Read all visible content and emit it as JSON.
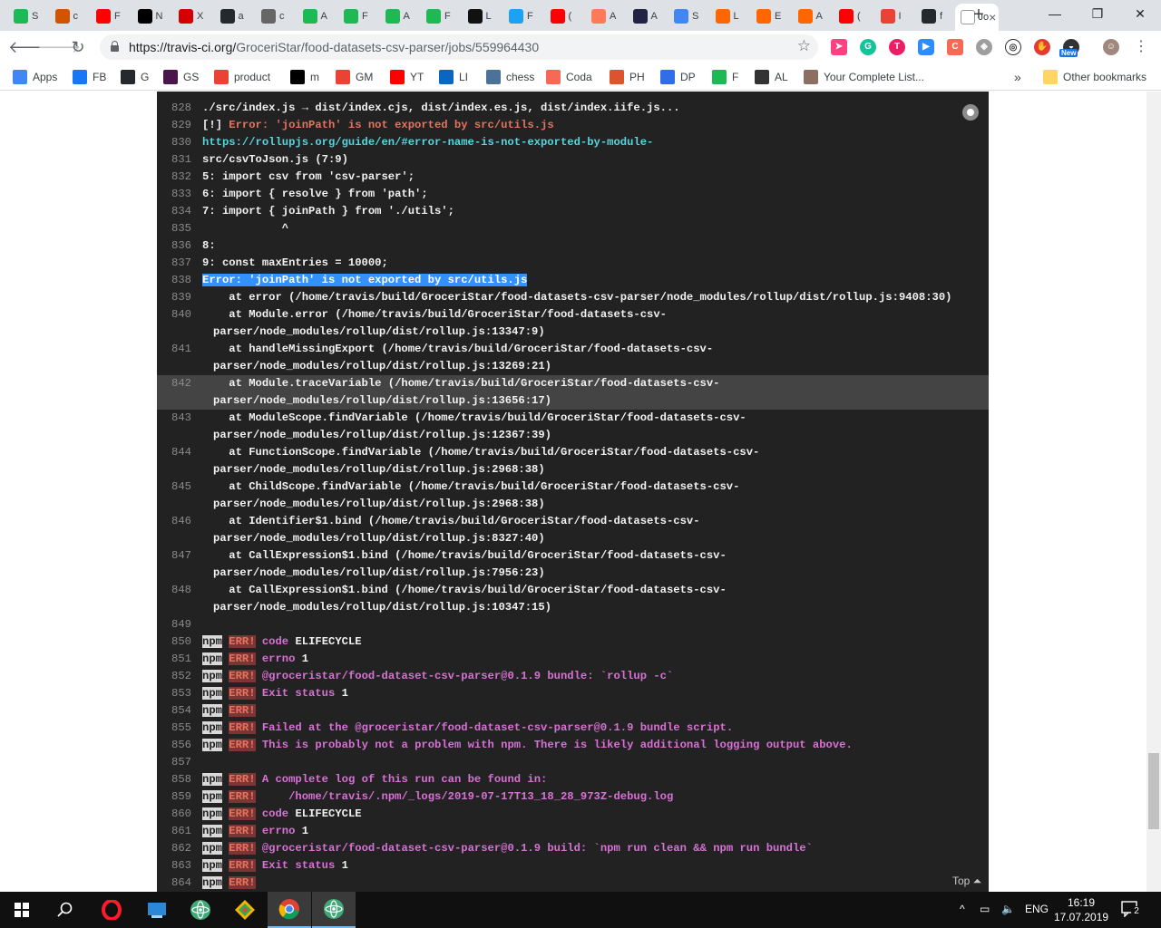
{
  "browser": {
    "tabs": [
      {
        "short": "S",
        "icon": "green-robot-icon",
        "color": "#1db954"
      },
      {
        "short": "c",
        "icon": "mustache-icon",
        "color": "#d35400"
      },
      {
        "short": "F",
        "icon": "youtube-icon",
        "color": "#ff0000"
      },
      {
        "short": "N",
        "icon": "medium-icon",
        "color": "#000000"
      },
      {
        "short": "X",
        "icon": "red-logo-icon",
        "color": "#d50000"
      },
      {
        "short": "a",
        "icon": "github-icon",
        "color": "#24292e"
      },
      {
        "short": "c",
        "icon": "gray-circle-icon",
        "color": "#666666"
      },
      {
        "short": "A",
        "icon": "green-robot-icon",
        "color": "#1db954"
      },
      {
        "short": "F",
        "icon": "green-robot-icon",
        "color": "#1db954"
      },
      {
        "short": "A",
        "icon": "green-robot-icon",
        "color": "#1db954"
      },
      {
        "short": "F",
        "icon": "green-robot-icon",
        "color": "#1db954"
      },
      {
        "short": "L",
        "icon": "black-a-icon",
        "color": "#111111"
      },
      {
        "short": "F",
        "icon": "blue-circle-icon",
        "color": "#1da1f2"
      },
      {
        "short": "(",
        "icon": "youtube-icon",
        "color": "#ff0000"
      },
      {
        "short": "A",
        "icon": "hubspot-icon",
        "color": "#ff7a59"
      },
      {
        "short": "A",
        "icon": "dark-square-icon",
        "color": "#222244"
      },
      {
        "short": "S",
        "icon": "docs-icon",
        "color": "#4285f4"
      },
      {
        "short": "L",
        "icon": "ycombinator-icon",
        "color": "#ff6600"
      },
      {
        "short": "E",
        "icon": "ycombinator-icon",
        "color": "#ff6600"
      },
      {
        "short": "A",
        "icon": "ycombinator-icon",
        "color": "#ff6600"
      },
      {
        "short": "(",
        "icon": "youtube-icon",
        "color": "#ff0000"
      },
      {
        "short": "I",
        "icon": "gmail-icon",
        "color": "#ea4335"
      },
      {
        "short": "f",
        "icon": "github-icon",
        "color": "#24292e"
      },
      {
        "short": "Jo",
        "icon": "travis-icon",
        "color": "#ffffff",
        "active": true
      }
    ],
    "new_tab": "+",
    "minimize": "—",
    "restore": "❐",
    "close": "✕",
    "url_host": "https://travis-ci.org/",
    "url_path": "GroceriStar/food-datasets-csv-parser/jobs/559964430",
    "bookmarks": [
      {
        "label": "Apps",
        "icon": "apps-grid-icon",
        "color": "#4285f4"
      },
      {
        "label": "FB",
        "icon": "facebook-icon",
        "color": "#1877f2"
      },
      {
        "label": "G",
        "icon": "github-icon",
        "color": "#24292e"
      },
      {
        "label": "GS",
        "icon": "slack-icon",
        "color": "#4a154b"
      },
      {
        "label": "product",
        "icon": "gmail-icon",
        "color": "#ea4335"
      },
      {
        "label": "m",
        "icon": "medium-icon",
        "color": "#000000"
      },
      {
        "label": "GM",
        "icon": "gmail-icon",
        "color": "#ea4335"
      },
      {
        "label": "YT",
        "icon": "youtube-icon",
        "color": "#ff0000"
      },
      {
        "label": "LI",
        "icon": "linkedin-icon",
        "color": "#0a66c2"
      },
      {
        "label": "chess",
        "icon": "chess-pawn-icon",
        "color": "#4b7399"
      },
      {
        "label": "Coda",
        "icon": "coda-icon",
        "color": "#f46a54"
      },
      {
        "label": "PH",
        "icon": "producthunt-icon",
        "color": "#da552f"
      },
      {
        "label": "DP",
        "icon": "devpost-icon",
        "color": "#2f6ee8"
      },
      {
        "label": "F",
        "icon": "green-robot-icon",
        "color": "#1db954"
      },
      {
        "label": "AL",
        "icon": "angellist-icon",
        "color": "#333333"
      },
      {
        "label": "Your Complete List...",
        "icon": "person-icon",
        "color": "#8d6e63"
      }
    ],
    "more_bookmarks": "»",
    "other_bookmarks": "Other bookmarks",
    "new_badge": "New"
  },
  "log": {
    "lines": [
      {
        "n": "828",
        "segs": [
          {
            "t": "./src/index.js → dist/index.cjs, dist/index.es.js, dist/index.iife.js...",
            "c": ""
          }
        ]
      },
      {
        "n": "829",
        "segs": [
          {
            "t": "[!] ",
            "c": ""
          },
          {
            "t": "Error: 'joinPath' is not exported by src/utils.js",
            "c": "red"
          }
        ]
      },
      {
        "n": "830",
        "segs": [
          {
            "t": "https://rollupjs.org/guide/en/#error-name-is-not-exported-by-module-",
            "c": "cyan"
          }
        ]
      },
      {
        "n": "831",
        "segs": [
          {
            "t": "src/csvToJson.js (7:9)",
            "c": ""
          }
        ]
      },
      {
        "n": "832",
        "segs": [
          {
            "t": "5: import csv from 'csv-parser';",
            "c": ""
          }
        ]
      },
      {
        "n": "833",
        "segs": [
          {
            "t": "6: import { resolve } from 'path';",
            "c": ""
          }
        ]
      },
      {
        "n": "834",
        "segs": [
          {
            "t": "7: import { joinPath } from './utils';",
            "c": ""
          }
        ]
      },
      {
        "n": "835",
        "segs": [
          {
            "t": "            ^",
            "c": ""
          }
        ]
      },
      {
        "n": "836",
        "segs": [
          {
            "t": "8:",
            "c": ""
          }
        ]
      },
      {
        "n": "837",
        "segs": [
          {
            "t": "9: const maxEntries = 10000;",
            "c": ""
          }
        ]
      },
      {
        "n": "838",
        "segs": [
          {
            "t": "Error: 'joinPath' is not exported by src/utils.js",
            "c": "sel"
          }
        ]
      },
      {
        "n": "839",
        "segs": [
          {
            "t": "    at error (/home/travis/build/GroceriStar/food-datasets-csv-parser/node_modules/rollup/dist/rollup.js:9408:30)",
            "c": ""
          }
        ]
      },
      {
        "n": "840",
        "segs": [
          {
            "t": "    at Module.error (/home/travis/build/GroceriStar/food-datasets-csv-",
            "c": ""
          }
        ]
      },
      {
        "n": "",
        "cont": true,
        "segs": [
          {
            "t": "parser/node_modules/rollup/dist/rollup.js:13347:9)",
            "c": ""
          }
        ]
      },
      {
        "n": "841",
        "segs": [
          {
            "t": "    at handleMissingExport (/home/travis/build/GroceriStar/food-datasets-csv-",
            "c": ""
          }
        ]
      },
      {
        "n": "",
        "cont": true,
        "segs": [
          {
            "t": "parser/node_modules/rollup/dist/rollup.js:13269:21)",
            "c": ""
          }
        ]
      },
      {
        "n": "842",
        "hl": true,
        "segs": [
          {
            "t": "    at Module.traceVariable (/home/travis/build/GroceriStar/food-datasets-csv-",
            "c": ""
          }
        ]
      },
      {
        "n": "",
        "cont": true,
        "hl": true,
        "segs": [
          {
            "t": "parser/node_modules/rollup/dist/rollup.js:13656:17)",
            "c": ""
          }
        ]
      },
      {
        "n": "843",
        "segs": [
          {
            "t": "    at ModuleScope.findVariable (/home/travis/build/GroceriStar/food-datasets-csv-",
            "c": ""
          }
        ]
      },
      {
        "n": "",
        "cont": true,
        "segs": [
          {
            "t": "parser/node_modules/rollup/dist/rollup.js:12367:39)",
            "c": ""
          }
        ]
      },
      {
        "n": "844",
        "segs": [
          {
            "t": "    at FunctionScope.findVariable (/home/travis/build/GroceriStar/food-datasets-csv-",
            "c": ""
          }
        ]
      },
      {
        "n": "",
        "cont": true,
        "segs": [
          {
            "t": "parser/node_modules/rollup/dist/rollup.js:2968:38)",
            "c": ""
          }
        ]
      },
      {
        "n": "845",
        "segs": [
          {
            "t": "    at ChildScope.findVariable (/home/travis/build/GroceriStar/food-datasets-csv-",
            "c": ""
          }
        ]
      },
      {
        "n": "",
        "cont": true,
        "segs": [
          {
            "t": "parser/node_modules/rollup/dist/rollup.js:2968:38)",
            "c": ""
          }
        ]
      },
      {
        "n": "846",
        "segs": [
          {
            "t": "    at Identifier$1.bind (/home/travis/build/GroceriStar/food-datasets-csv-",
            "c": ""
          }
        ]
      },
      {
        "n": "",
        "cont": true,
        "segs": [
          {
            "t": "parser/node_modules/rollup/dist/rollup.js:8327:40)",
            "c": ""
          }
        ]
      },
      {
        "n": "847",
        "segs": [
          {
            "t": "    at CallExpression$1.bind (/home/travis/build/GroceriStar/food-datasets-csv-",
            "c": ""
          }
        ]
      },
      {
        "n": "",
        "cont": true,
        "segs": [
          {
            "t": "parser/node_modules/rollup/dist/rollup.js:7956:23)",
            "c": ""
          }
        ]
      },
      {
        "n": "848",
        "segs": [
          {
            "t": "    at CallExpression$1.bind (/home/travis/build/GroceriStar/food-datasets-csv-",
            "c": ""
          }
        ]
      },
      {
        "n": "",
        "cont": true,
        "segs": [
          {
            "t": "parser/node_modules/rollup/dist/rollup.js:10347:15)",
            "c": ""
          }
        ]
      },
      {
        "n": "849",
        "segs": []
      },
      {
        "n": "850",
        "segs": [
          {
            "t": "npm",
            "c": "npm"
          },
          {
            "t": " ",
            "c": ""
          },
          {
            "t": "ERR!",
            "c": "err"
          },
          {
            "t": " code ",
            "c": "magenta"
          },
          {
            "t": "ELIFECYCLE",
            "c": ""
          }
        ]
      },
      {
        "n": "851",
        "segs": [
          {
            "t": "npm",
            "c": "npm"
          },
          {
            "t": " ",
            "c": ""
          },
          {
            "t": "ERR!",
            "c": "err"
          },
          {
            "t": " errno ",
            "c": "magenta"
          },
          {
            "t": "1",
            "c": ""
          }
        ]
      },
      {
        "n": "852",
        "segs": [
          {
            "t": "npm",
            "c": "npm"
          },
          {
            "t": " ",
            "c": ""
          },
          {
            "t": "ERR!",
            "c": "err"
          },
          {
            "t": " @groceristar/food-dataset-csv-parser@0.1.9 bundle: `rollup -c`",
            "c": "magenta"
          }
        ]
      },
      {
        "n": "853",
        "segs": [
          {
            "t": "npm",
            "c": "npm"
          },
          {
            "t": " ",
            "c": ""
          },
          {
            "t": "ERR!",
            "c": "err"
          },
          {
            "t": " Exit status ",
            "c": "magenta"
          },
          {
            "t": "1",
            "c": ""
          }
        ]
      },
      {
        "n": "854",
        "segs": [
          {
            "t": "npm",
            "c": "npm"
          },
          {
            "t": " ",
            "c": ""
          },
          {
            "t": "ERR!",
            "c": "err"
          }
        ]
      },
      {
        "n": "855",
        "segs": [
          {
            "t": "npm",
            "c": "npm"
          },
          {
            "t": " ",
            "c": ""
          },
          {
            "t": "ERR!",
            "c": "err"
          },
          {
            "t": " Failed at the @groceristar/food-dataset-csv-parser@0.1.9 bundle script.",
            "c": "magenta"
          }
        ]
      },
      {
        "n": "856",
        "segs": [
          {
            "t": "npm",
            "c": "npm"
          },
          {
            "t": " ",
            "c": ""
          },
          {
            "t": "ERR!",
            "c": "err"
          },
          {
            "t": " This is probably not a problem with npm. There is likely additional logging output above.",
            "c": "magenta"
          }
        ]
      },
      {
        "n": "857",
        "segs": []
      },
      {
        "n": "858",
        "segs": [
          {
            "t": "npm",
            "c": "npm"
          },
          {
            "t": " ",
            "c": ""
          },
          {
            "t": "ERR!",
            "c": "err"
          },
          {
            "t": " A complete log of this run can be found in:",
            "c": "magenta"
          }
        ]
      },
      {
        "n": "859",
        "segs": [
          {
            "t": "npm",
            "c": "npm"
          },
          {
            "t": " ",
            "c": ""
          },
          {
            "t": "ERR!",
            "c": "err"
          },
          {
            "t": "     /home/travis/.npm/_logs/2019-07-17T13_18_28_973Z-debug.log",
            "c": "magenta"
          }
        ]
      },
      {
        "n": "860",
        "segs": [
          {
            "t": "npm",
            "c": "npm"
          },
          {
            "t": " ",
            "c": ""
          },
          {
            "t": "ERR!",
            "c": "err"
          },
          {
            "t": " code ",
            "c": "magenta"
          },
          {
            "t": "ELIFECYCLE",
            "c": ""
          }
        ]
      },
      {
        "n": "861",
        "segs": [
          {
            "t": "npm",
            "c": "npm"
          },
          {
            "t": " ",
            "c": ""
          },
          {
            "t": "ERR!",
            "c": "err"
          },
          {
            "t": " errno ",
            "c": "magenta"
          },
          {
            "t": "1",
            "c": ""
          }
        ]
      },
      {
        "n": "862",
        "segs": [
          {
            "t": "npm",
            "c": "npm"
          },
          {
            "t": " ",
            "c": ""
          },
          {
            "t": "ERR!",
            "c": "err"
          },
          {
            "t": " @groceristar/food-dataset-csv-parser@0.1.9 build: `npm run clean && npm run bundle`",
            "c": "magenta"
          }
        ]
      },
      {
        "n": "863",
        "segs": [
          {
            "t": "npm",
            "c": "npm"
          },
          {
            "t": " ",
            "c": ""
          },
          {
            "t": "ERR!",
            "c": "err"
          },
          {
            "t": " Exit status ",
            "c": "magenta"
          },
          {
            "t": "1",
            "c": ""
          }
        ]
      },
      {
        "n": "864",
        "segs": [
          {
            "t": "npm",
            "c": "npm"
          },
          {
            "t": " ",
            "c": ""
          },
          {
            "t": "ERR!",
            "c": "err"
          }
        ]
      }
    ],
    "top_label": "Top ⏶"
  },
  "taskbar": {
    "language": "ENG",
    "time": "16:19",
    "date": "17.07.2019",
    "notifications": "2"
  }
}
